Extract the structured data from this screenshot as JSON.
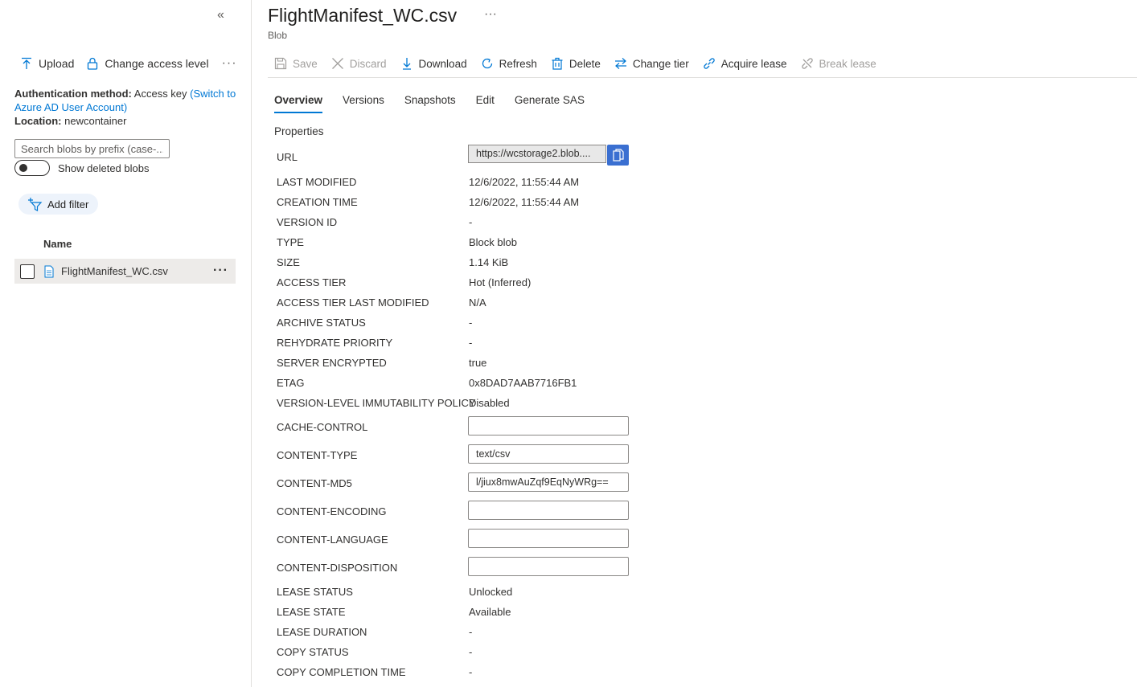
{
  "left": {
    "collapse_glyph": "«",
    "toolbar": {
      "upload_label": "Upload",
      "change_access_label": "Change access level",
      "more": "···"
    },
    "auth": {
      "method_label": "Authentication method:",
      "method_value": "Access key",
      "switch_link": "(Switch to Azure AD User Account)",
      "location_label": "Location:",
      "location_value": "newcontainer"
    },
    "search_placeholder": "Search blobs by prefix (case-...",
    "show_deleted_label": "Show deleted blobs",
    "add_filter_label": "Add filter",
    "column_name": "Name",
    "files": [
      {
        "name": "FlightManifest_WC.csv"
      }
    ]
  },
  "main": {
    "title": "FlightManifest_WC.csv",
    "title_more": "···",
    "subtitle": "Blob",
    "toolbar": {
      "save": "Save",
      "discard": "Discard",
      "download": "Download",
      "refresh": "Refresh",
      "delete": "Delete",
      "change_tier": "Change tier",
      "acquire_lease": "Acquire lease",
      "break_lease": "Break lease"
    },
    "tabs": [
      "Overview",
      "Versions",
      "Snapshots",
      "Edit",
      "Generate SAS"
    ],
    "properties_header": "Properties",
    "url_label": "URL",
    "url_value": "https://wcstorage2.blob....",
    "props": [
      {
        "label": "LAST MODIFIED",
        "value": "12/6/2022, 11:55:44 AM"
      },
      {
        "label": "CREATION TIME",
        "value": "12/6/2022, 11:55:44 AM"
      },
      {
        "label": "VERSION ID",
        "value": "-"
      },
      {
        "label": "TYPE",
        "value": "Block blob"
      },
      {
        "label": "SIZE",
        "value": "1.14 KiB"
      },
      {
        "label": "ACCESS TIER",
        "value": "Hot (Inferred)"
      },
      {
        "label": "ACCESS TIER LAST MODIFIED",
        "value": "N/A"
      },
      {
        "label": "ARCHIVE STATUS",
        "value": "-"
      },
      {
        "label": "REHYDRATE PRIORITY",
        "value": "-"
      },
      {
        "label": "SERVER ENCRYPTED",
        "value": "true"
      },
      {
        "label": "ETAG",
        "value": "0x8DAD7AAB7716FB1"
      },
      {
        "label": "VERSION-LEVEL IMMUTABILITY POLICY",
        "value": "Disabled"
      }
    ],
    "inputs": [
      {
        "label": "CACHE-CONTROL",
        "value": ""
      },
      {
        "label": "CONTENT-TYPE",
        "value": "text/csv"
      },
      {
        "label": "CONTENT-MD5",
        "value": "l/jiux8mwAuZqf9EqNyWRg=="
      },
      {
        "label": "CONTENT-ENCODING",
        "value": ""
      },
      {
        "label": "CONTENT-LANGUAGE",
        "value": ""
      },
      {
        "label": "CONTENT-DISPOSITION",
        "value": ""
      }
    ],
    "lease": [
      {
        "label": "LEASE STATUS",
        "value": "Unlocked"
      },
      {
        "label": "LEASE STATE",
        "value": "Available"
      },
      {
        "label": "LEASE DURATION",
        "value": "-"
      },
      {
        "label": "COPY STATUS",
        "value": "-"
      },
      {
        "label": "COPY COMPLETION TIME",
        "value": "-"
      }
    ]
  }
}
